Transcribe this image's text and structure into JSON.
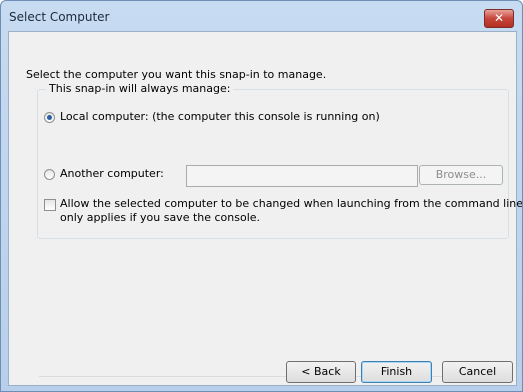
{
  "window": {
    "title": "Select Computer",
    "close_glyph": "✕"
  },
  "intro_text": "Select the computer you want this snap-in to manage.",
  "group": {
    "label": "This snap-in will always manage:",
    "local_option": {
      "label": "Local computer:  (the computer this console is running on)",
      "checked": true
    },
    "another_option": {
      "label": "Another computer:",
      "checked": false,
      "value": ""
    },
    "browse_label": "Browse...",
    "allow_change": {
      "line1": "Allow the selected computer to be changed when launching from the command line.  This",
      "line2": "only applies if you save the console.",
      "checked": false
    }
  },
  "buttons": {
    "back": "< Back",
    "finish": "Finish",
    "cancel": "Cancel"
  }
}
